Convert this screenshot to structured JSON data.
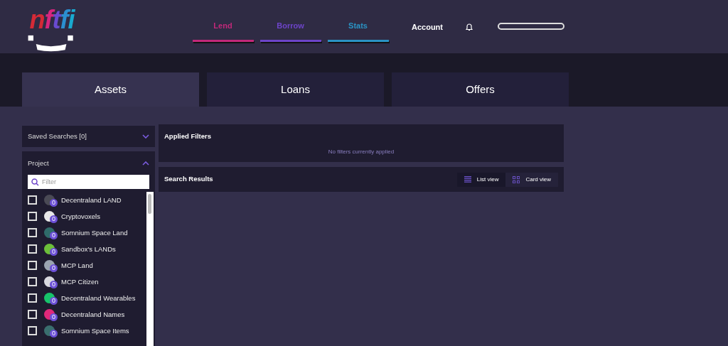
{
  "logo": {
    "letters": [
      {
        "text": "n",
        "color": "#d42a36"
      },
      {
        "text": "f",
        "color": "#d6267f"
      },
      {
        "text": "t",
        "color": "#6a4bd0"
      },
      {
        "text": "f",
        "color": "#2b8fd0"
      },
      {
        "text": "i",
        "color": "#19a9cf"
      }
    ]
  },
  "nav": [
    {
      "label": "Lend",
      "color": "#c2287a"
    },
    {
      "label": "Borrow",
      "color": "#6d44c9"
    },
    {
      "label": "Stats",
      "color": "#2a93c4"
    }
  ],
  "account": "Account",
  "tabs": [
    {
      "label": "Assets",
      "selected": true
    },
    {
      "label": "Loans",
      "selected": false
    },
    {
      "label": "Offers",
      "selected": false
    }
  ],
  "saved_searches": {
    "label": "Saved Searches [0]",
    "expanded": false
  },
  "project": {
    "label": "Project",
    "expanded": true,
    "filter_placeholder": "Filter",
    "items": [
      {
        "name": "Decentraland LAND",
        "count": "0",
        "checked": false,
        "color": "#4a4a55"
      },
      {
        "name": "Cryptovoxels",
        "count": "0",
        "checked": false,
        "color": "#e8e8e8"
      },
      {
        "name": "Somnium Space Land",
        "count": "0",
        "checked": false,
        "color": "#2f6b6a"
      },
      {
        "name": "Sandbox's LANDs",
        "count": "0",
        "checked": false,
        "color": "#6cbf3a"
      },
      {
        "name": "MCP Land",
        "count": "0",
        "checked": false,
        "color": "#9aa3b0"
      },
      {
        "name": "MCP Citizen",
        "count": "0",
        "checked": false,
        "color": "#d9d9e0"
      },
      {
        "name": "Decentraland Wearables",
        "count": "0",
        "checked": false,
        "color": "#17c46a"
      },
      {
        "name": "Decentraland Names",
        "count": "0",
        "checked": false,
        "color": "#e0287a"
      },
      {
        "name": "Somnium Space Items",
        "count": "0",
        "checked": false,
        "color": "#3a6e6e"
      }
    ]
  },
  "applied_filters": {
    "title": "Applied Filters",
    "empty": "No filters currently applied"
  },
  "search_results": {
    "title": "Search Results",
    "views": [
      {
        "kind": "list",
        "label": "List view",
        "selected": true
      },
      {
        "kind": "card",
        "label": "Card view",
        "selected": false
      }
    ]
  }
}
